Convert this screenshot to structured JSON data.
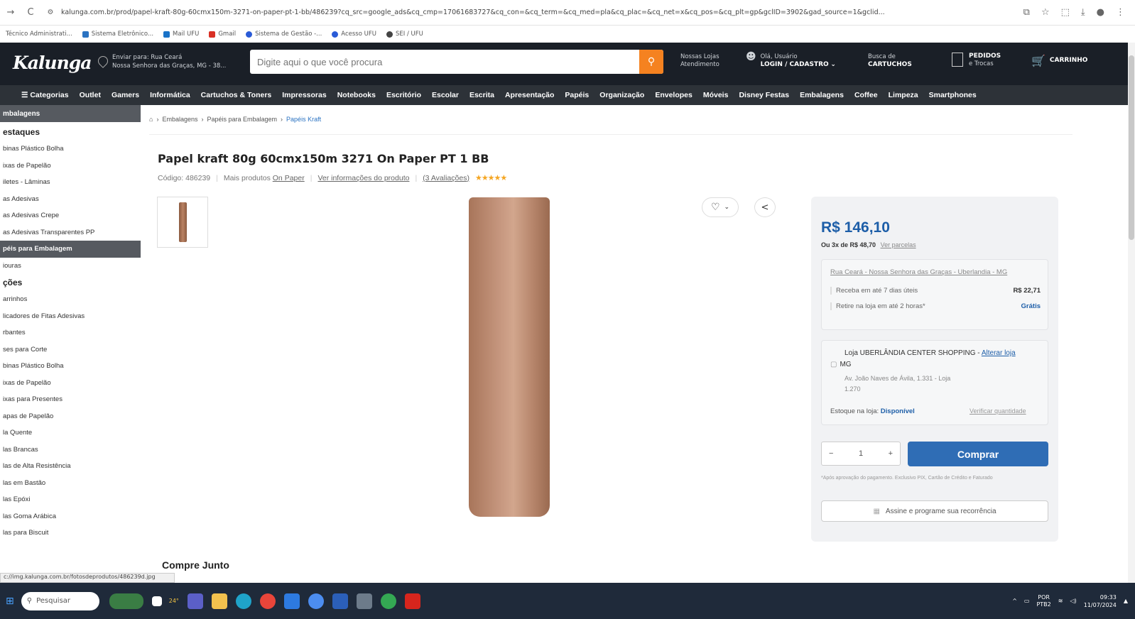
{
  "browser": {
    "back": "→",
    "reload": "C",
    "url": "kalunga.com.br/prod/papel-kraft-80g-60cmx150m-3271-on-paper-pt-1-bb/486239?cq_src=google_ads&cq_cmp=17061683727&cq_con=&cq_term=&cq_med=pla&cq_plac=&cq_net=x&cq_pos=&cq_plt=gp&gclID=3902&gad_source=1&gclid...",
    "bookmarks": [
      "Técnico Administrati...",
      "Sistema Eletrônico...",
      "Mail UFU",
      "Gmail",
      "Sistema de Gestão -...",
      "Acesso UFU",
      "SEI / UFU"
    ]
  },
  "header": {
    "logo": "Kalunga",
    "deliver_line1": "Enviar para: Rua Ceará",
    "deliver_line2": "Nossa Senhora das Graças, MG - 38...",
    "search_placeholder": "Digite aqui o que você procura",
    "stores_line1": "Nossas Lojas",
    "stores_line2": "Atendimento",
    "user_line1": "Olá, Usuário",
    "user_line2": "LOGIN / CADASTRO",
    "cartridge_line1": "Busca de",
    "cartridge_line2": "CARTUCHOS",
    "orders_line1": "PEDIDOS",
    "orders_line2": "e Trocas",
    "cart": "CARRINHO"
  },
  "nav": [
    "☰ Categorias",
    "Outlet",
    "Gamers",
    "Informática",
    "Cartuchos & Toners",
    "Impressoras",
    "Notebooks",
    "Escritório",
    "Escolar",
    "Escrita",
    "Apresentação",
    "Papéis",
    "Organização",
    "Envelopes",
    "Móveis",
    "Disney Festas",
    "Embalagens",
    "Coffee",
    "Limpeza",
    "Smartphones"
  ],
  "sidebar": {
    "active": "mbalagens",
    "heading1": "estaques",
    "items1": [
      "binas Plástico Bolha",
      "ixas de Papelão",
      "iletes - Lâminas",
      "as Adesivas",
      "as Adesivas Crepe",
      "as Adesivas Transparentes PP",
      "péis para Embalagem",
      "iouras"
    ],
    "heading2": "ções",
    "items2": [
      "arrinhos",
      "licadores de Fitas Adesivas",
      "rbantes",
      "ses para Corte",
      "binas Plástico Bolha",
      "ixas de Papelão",
      "ixas para Presentes",
      "apas de Papelão",
      "la Quente",
      "las Brancas",
      "las de Alta Resistência",
      "las em Bastão",
      "las Epóxi",
      "las Goma Arábica",
      "las para Biscuit"
    ]
  },
  "status_url": "c://img.kalunga.com.br/fotosdeprodutos/486239d.jpg",
  "breadcrumb": [
    "Embalagens",
    "Papéis para Embalagem",
    "Papéis Kraft"
  ],
  "product": {
    "title": "Papel kraft 80g 60cmx150m 3271 On Paper PT 1 BB",
    "code": "Código: 486239",
    "more": "Mais produtos",
    "brand": "On Paper",
    "info_link": "Ver informações do produto",
    "reviews": "(3 Avaliações)",
    "stars": "★★★★★"
  },
  "buy": {
    "price": "R$ 146,10",
    "installments_text": "Ou 3x de R$ 48,70",
    "installments_link": "Ver parcelas",
    "address": "Rua Ceará - Nossa Senhora das Graças - Uberlandia - MG",
    "ship1_label": "Receba em até 7 dias úteis",
    "ship1_value": "R$ 22,71",
    "ship2_label": "Retire na loja em até 2 horas*",
    "ship2_value": "Grátis",
    "store_name": "Loja UBERLÂNDIA CENTER SHOPPING -",
    "store_change": "Alterar loja",
    "store_state": "MG",
    "store_addr1": "Av. João Naves de Ávila, 1.331 - Loja",
    "store_addr2": "1.270",
    "stock_label": "Estoque na loja:",
    "stock_value": "Disponível",
    "stock_check": "Verificar quantidade",
    "qty": "1",
    "buy_label": "Comprar",
    "legal": "*Após aprovação do pagamento. Exclusivo PIX, Cartão de Crédito e Faturado",
    "subscribe": "Assine e programe sua recorrência"
  },
  "section": "Compre Junto",
  "taskbar": {
    "search": "Pesquisar",
    "lang1": "POR",
    "lang2": "PTB2",
    "time": "09:33",
    "date": "11/07/2024",
    "temp": "24°"
  }
}
